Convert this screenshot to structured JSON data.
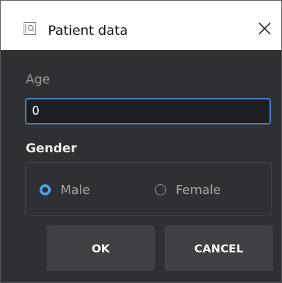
{
  "window": {
    "title": "Patient data",
    "app_icon": "magnifier-window-icon",
    "close_icon": "close-icon"
  },
  "form": {
    "age_label": "Age",
    "age_value": "0",
    "gender_label": "Gender",
    "gender_options": [
      {
        "label": "Male",
        "selected": true
      },
      {
        "label": "Female",
        "selected": false
      }
    ]
  },
  "buttons": {
    "ok_label": "OK",
    "cancel_label": "CANCEL"
  },
  "colors": {
    "dialog_bg": "#2f3033",
    "accent": "#4d9fe8",
    "input_border": "#4d7fc6",
    "button_bg": "#3f4043"
  }
}
